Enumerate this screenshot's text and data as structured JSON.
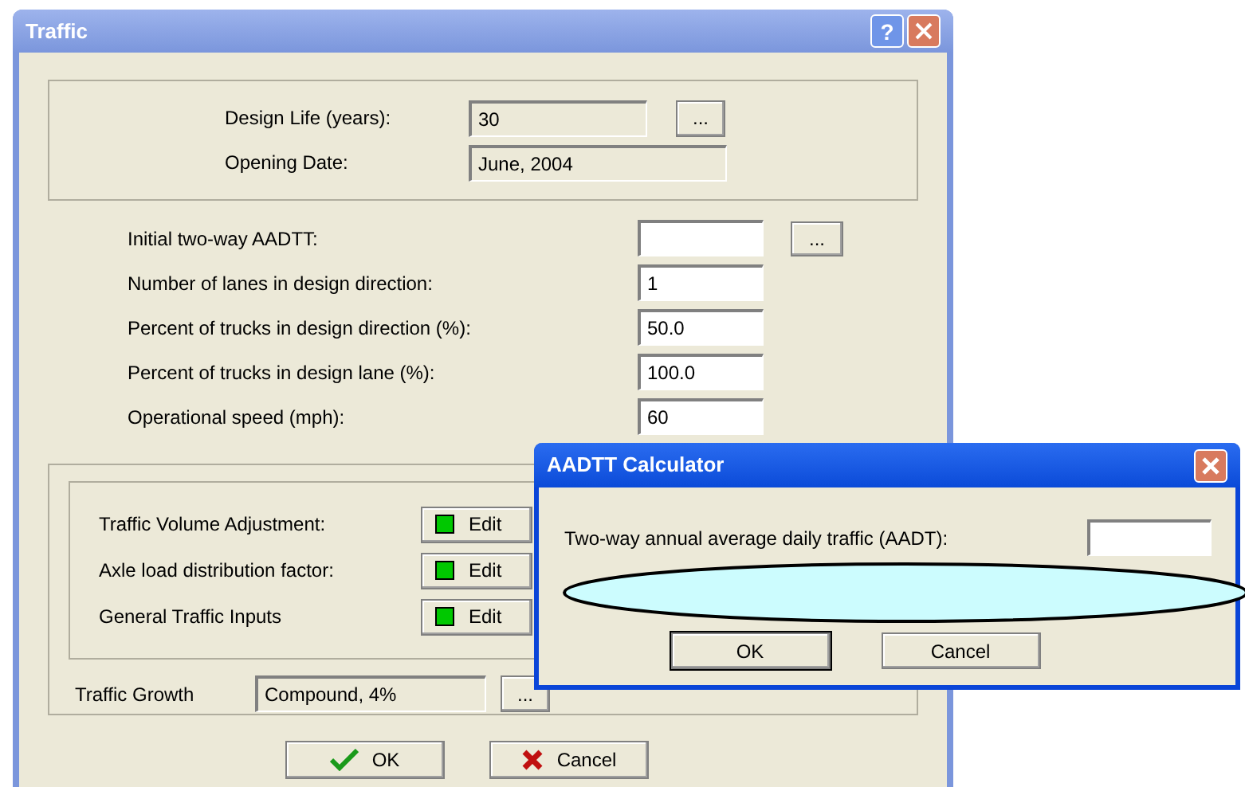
{
  "window": {
    "title": "Traffic",
    "help_button": "?"
  },
  "design": [
    {
      "label": "Design Life (years):",
      "value": "30",
      "browse": "..."
    },
    {
      "label": "Opening Date:",
      "value": "June, 2004"
    }
  ],
  "volume": [
    {
      "label": "Initial two-way AADTT:",
      "browse": "..."
    },
    {
      "label": "Number of lanes in design direction:",
      "value": "1"
    },
    {
      "label": "Percent of trucks in design direction (%):",
      "value": "50.0"
    },
    {
      "label": "Percent of trucks in design lane (%):",
      "value": "100.0"
    },
    {
      "label": "Operational speed (mph):",
      "value": "60"
    }
  ],
  "factors": [
    {
      "label": "Traffic Volume Adjustment:",
      "button": "Edit",
      "color": "#00c800"
    },
    {
      "label": "Axle load distribution factor:",
      "button": "Edit",
      "color": "#00c800"
    },
    {
      "label": "General Traffic Inputs",
      "button": "Edit",
      "color": "#00c800"
    }
  ],
  "growth": {
    "label": "Traffic Growth",
    "value": "Compound, 4%",
    "browse": "..."
  },
  "buttons": [
    {
      "kind": "ok",
      "label": "OK"
    },
    {
      "kind": "cancel",
      "label": "Cancel"
    }
  ],
  "calculator": {
    "title": "AADTT Calculator",
    "label": "Two-way annual average daily traffic (AADT):",
    "buttons": [
      "OK",
      "Cancel"
    ]
  }
}
